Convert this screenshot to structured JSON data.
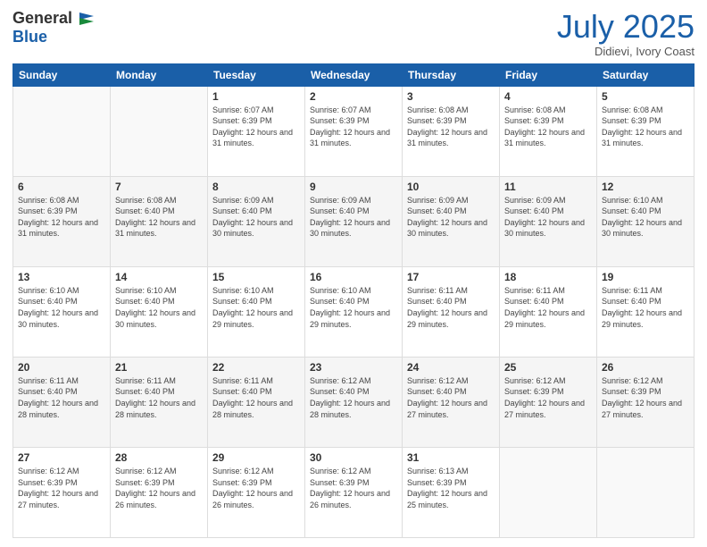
{
  "header": {
    "logo_general": "General",
    "logo_blue": "Blue",
    "month_title": "July 2025",
    "location": "Didievi, Ivory Coast"
  },
  "days_of_week": [
    "Sunday",
    "Monday",
    "Tuesday",
    "Wednesday",
    "Thursday",
    "Friday",
    "Saturday"
  ],
  "weeks": [
    [
      {
        "day": "",
        "info": ""
      },
      {
        "day": "",
        "info": ""
      },
      {
        "day": "1",
        "info": "Sunrise: 6:07 AM\nSunset: 6:39 PM\nDaylight: 12 hours and 31 minutes."
      },
      {
        "day": "2",
        "info": "Sunrise: 6:07 AM\nSunset: 6:39 PM\nDaylight: 12 hours and 31 minutes."
      },
      {
        "day": "3",
        "info": "Sunrise: 6:08 AM\nSunset: 6:39 PM\nDaylight: 12 hours and 31 minutes."
      },
      {
        "day": "4",
        "info": "Sunrise: 6:08 AM\nSunset: 6:39 PM\nDaylight: 12 hours and 31 minutes."
      },
      {
        "day": "5",
        "info": "Sunrise: 6:08 AM\nSunset: 6:39 PM\nDaylight: 12 hours and 31 minutes."
      }
    ],
    [
      {
        "day": "6",
        "info": "Sunrise: 6:08 AM\nSunset: 6:39 PM\nDaylight: 12 hours and 31 minutes."
      },
      {
        "day": "7",
        "info": "Sunrise: 6:08 AM\nSunset: 6:40 PM\nDaylight: 12 hours and 31 minutes."
      },
      {
        "day": "8",
        "info": "Sunrise: 6:09 AM\nSunset: 6:40 PM\nDaylight: 12 hours and 30 minutes."
      },
      {
        "day": "9",
        "info": "Sunrise: 6:09 AM\nSunset: 6:40 PM\nDaylight: 12 hours and 30 minutes."
      },
      {
        "day": "10",
        "info": "Sunrise: 6:09 AM\nSunset: 6:40 PM\nDaylight: 12 hours and 30 minutes."
      },
      {
        "day": "11",
        "info": "Sunrise: 6:09 AM\nSunset: 6:40 PM\nDaylight: 12 hours and 30 minutes."
      },
      {
        "day": "12",
        "info": "Sunrise: 6:10 AM\nSunset: 6:40 PM\nDaylight: 12 hours and 30 minutes."
      }
    ],
    [
      {
        "day": "13",
        "info": "Sunrise: 6:10 AM\nSunset: 6:40 PM\nDaylight: 12 hours and 30 minutes."
      },
      {
        "day": "14",
        "info": "Sunrise: 6:10 AM\nSunset: 6:40 PM\nDaylight: 12 hours and 30 minutes."
      },
      {
        "day": "15",
        "info": "Sunrise: 6:10 AM\nSunset: 6:40 PM\nDaylight: 12 hours and 29 minutes."
      },
      {
        "day": "16",
        "info": "Sunrise: 6:10 AM\nSunset: 6:40 PM\nDaylight: 12 hours and 29 minutes."
      },
      {
        "day": "17",
        "info": "Sunrise: 6:11 AM\nSunset: 6:40 PM\nDaylight: 12 hours and 29 minutes."
      },
      {
        "day": "18",
        "info": "Sunrise: 6:11 AM\nSunset: 6:40 PM\nDaylight: 12 hours and 29 minutes."
      },
      {
        "day": "19",
        "info": "Sunrise: 6:11 AM\nSunset: 6:40 PM\nDaylight: 12 hours and 29 minutes."
      }
    ],
    [
      {
        "day": "20",
        "info": "Sunrise: 6:11 AM\nSunset: 6:40 PM\nDaylight: 12 hours and 28 minutes."
      },
      {
        "day": "21",
        "info": "Sunrise: 6:11 AM\nSunset: 6:40 PM\nDaylight: 12 hours and 28 minutes."
      },
      {
        "day": "22",
        "info": "Sunrise: 6:11 AM\nSunset: 6:40 PM\nDaylight: 12 hours and 28 minutes."
      },
      {
        "day": "23",
        "info": "Sunrise: 6:12 AM\nSunset: 6:40 PM\nDaylight: 12 hours and 28 minutes."
      },
      {
        "day": "24",
        "info": "Sunrise: 6:12 AM\nSunset: 6:40 PM\nDaylight: 12 hours and 27 minutes."
      },
      {
        "day": "25",
        "info": "Sunrise: 6:12 AM\nSunset: 6:39 PM\nDaylight: 12 hours and 27 minutes."
      },
      {
        "day": "26",
        "info": "Sunrise: 6:12 AM\nSunset: 6:39 PM\nDaylight: 12 hours and 27 minutes."
      }
    ],
    [
      {
        "day": "27",
        "info": "Sunrise: 6:12 AM\nSunset: 6:39 PM\nDaylight: 12 hours and 27 minutes."
      },
      {
        "day": "28",
        "info": "Sunrise: 6:12 AM\nSunset: 6:39 PM\nDaylight: 12 hours and 26 minutes."
      },
      {
        "day": "29",
        "info": "Sunrise: 6:12 AM\nSunset: 6:39 PM\nDaylight: 12 hours and 26 minutes."
      },
      {
        "day": "30",
        "info": "Sunrise: 6:12 AM\nSunset: 6:39 PM\nDaylight: 12 hours and 26 minutes."
      },
      {
        "day": "31",
        "info": "Sunrise: 6:13 AM\nSunset: 6:39 PM\nDaylight: 12 hours and 25 minutes."
      },
      {
        "day": "",
        "info": ""
      },
      {
        "day": "",
        "info": ""
      }
    ]
  ]
}
